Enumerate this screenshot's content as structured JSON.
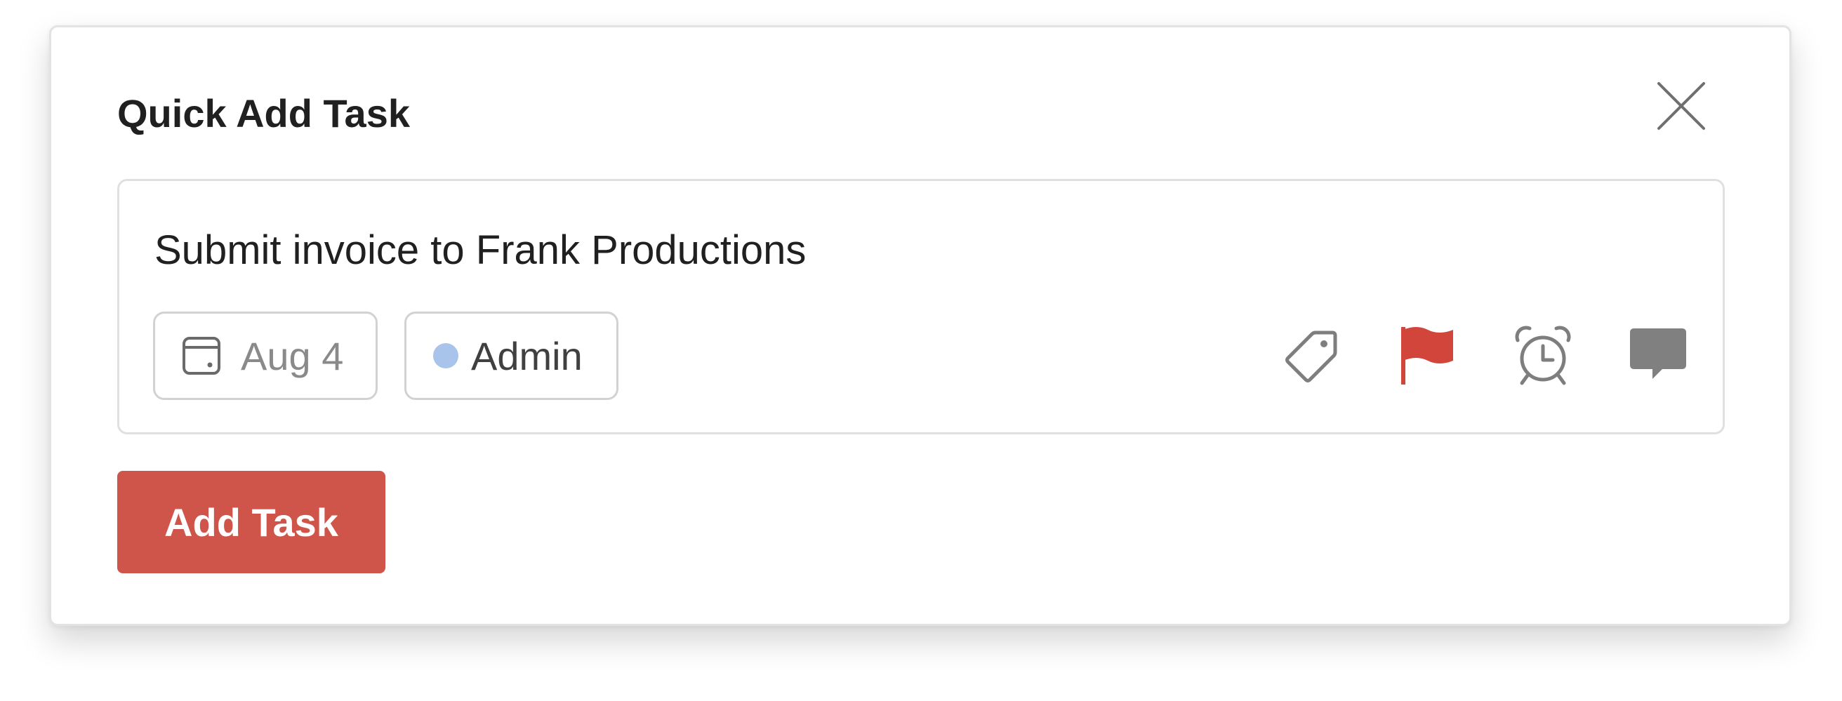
{
  "dialog": {
    "title": "Quick Add Task"
  },
  "task": {
    "content": "Submit invoice to Frank Productions"
  },
  "chips": {
    "due_date": {
      "label": "Aug 4",
      "icon": "calendar-icon"
    },
    "project": {
      "label": "Admin",
      "dot_color": "#a9c4ea"
    }
  },
  "toolbar": {
    "icons": [
      "tag-icon",
      "flag-icon",
      "alarm-clock-icon",
      "comment-icon"
    ],
    "priority_color": "#d1453b",
    "icon_color": "#808080"
  },
  "actions": {
    "submit_label": "Add Task",
    "submit_color": "#cf5449"
  }
}
